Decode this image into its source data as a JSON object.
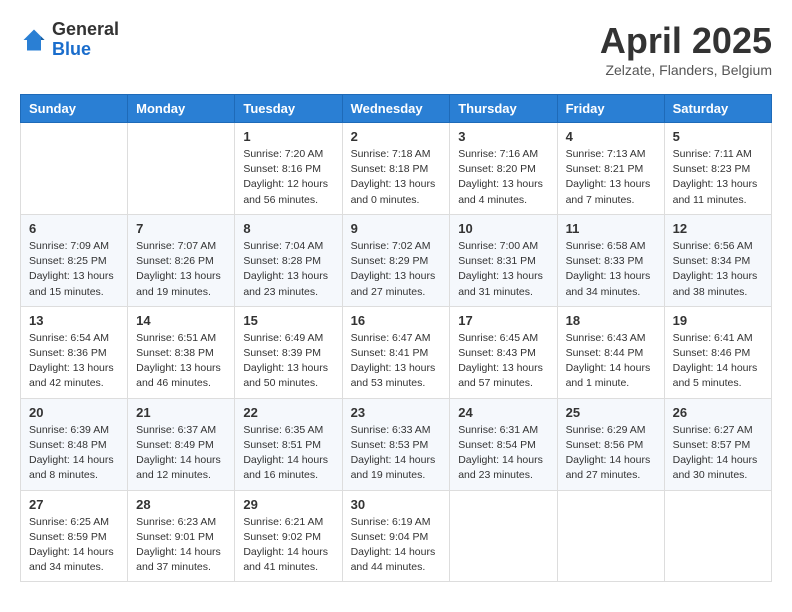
{
  "header": {
    "logo_general": "General",
    "logo_blue": "Blue",
    "month_title": "April 2025",
    "subtitle": "Zelzate, Flanders, Belgium"
  },
  "days_of_week": [
    "Sunday",
    "Monday",
    "Tuesday",
    "Wednesday",
    "Thursday",
    "Friday",
    "Saturday"
  ],
  "weeks": [
    [
      {
        "num": "",
        "info": ""
      },
      {
        "num": "",
        "info": ""
      },
      {
        "num": "1",
        "info": "Sunrise: 7:20 AM\nSunset: 8:16 PM\nDaylight: 12 hours and 56 minutes."
      },
      {
        "num": "2",
        "info": "Sunrise: 7:18 AM\nSunset: 8:18 PM\nDaylight: 13 hours and 0 minutes."
      },
      {
        "num": "3",
        "info": "Sunrise: 7:16 AM\nSunset: 8:20 PM\nDaylight: 13 hours and 4 minutes."
      },
      {
        "num": "4",
        "info": "Sunrise: 7:13 AM\nSunset: 8:21 PM\nDaylight: 13 hours and 7 minutes."
      },
      {
        "num": "5",
        "info": "Sunrise: 7:11 AM\nSunset: 8:23 PM\nDaylight: 13 hours and 11 minutes."
      }
    ],
    [
      {
        "num": "6",
        "info": "Sunrise: 7:09 AM\nSunset: 8:25 PM\nDaylight: 13 hours and 15 minutes."
      },
      {
        "num": "7",
        "info": "Sunrise: 7:07 AM\nSunset: 8:26 PM\nDaylight: 13 hours and 19 minutes."
      },
      {
        "num": "8",
        "info": "Sunrise: 7:04 AM\nSunset: 8:28 PM\nDaylight: 13 hours and 23 minutes."
      },
      {
        "num": "9",
        "info": "Sunrise: 7:02 AM\nSunset: 8:29 PM\nDaylight: 13 hours and 27 minutes."
      },
      {
        "num": "10",
        "info": "Sunrise: 7:00 AM\nSunset: 8:31 PM\nDaylight: 13 hours and 31 minutes."
      },
      {
        "num": "11",
        "info": "Sunrise: 6:58 AM\nSunset: 8:33 PM\nDaylight: 13 hours and 34 minutes."
      },
      {
        "num": "12",
        "info": "Sunrise: 6:56 AM\nSunset: 8:34 PM\nDaylight: 13 hours and 38 minutes."
      }
    ],
    [
      {
        "num": "13",
        "info": "Sunrise: 6:54 AM\nSunset: 8:36 PM\nDaylight: 13 hours and 42 minutes."
      },
      {
        "num": "14",
        "info": "Sunrise: 6:51 AM\nSunset: 8:38 PM\nDaylight: 13 hours and 46 minutes."
      },
      {
        "num": "15",
        "info": "Sunrise: 6:49 AM\nSunset: 8:39 PM\nDaylight: 13 hours and 50 minutes."
      },
      {
        "num": "16",
        "info": "Sunrise: 6:47 AM\nSunset: 8:41 PM\nDaylight: 13 hours and 53 minutes."
      },
      {
        "num": "17",
        "info": "Sunrise: 6:45 AM\nSunset: 8:43 PM\nDaylight: 13 hours and 57 minutes."
      },
      {
        "num": "18",
        "info": "Sunrise: 6:43 AM\nSunset: 8:44 PM\nDaylight: 14 hours and 1 minute."
      },
      {
        "num": "19",
        "info": "Sunrise: 6:41 AM\nSunset: 8:46 PM\nDaylight: 14 hours and 5 minutes."
      }
    ],
    [
      {
        "num": "20",
        "info": "Sunrise: 6:39 AM\nSunset: 8:48 PM\nDaylight: 14 hours and 8 minutes."
      },
      {
        "num": "21",
        "info": "Sunrise: 6:37 AM\nSunset: 8:49 PM\nDaylight: 14 hours and 12 minutes."
      },
      {
        "num": "22",
        "info": "Sunrise: 6:35 AM\nSunset: 8:51 PM\nDaylight: 14 hours and 16 minutes."
      },
      {
        "num": "23",
        "info": "Sunrise: 6:33 AM\nSunset: 8:53 PM\nDaylight: 14 hours and 19 minutes."
      },
      {
        "num": "24",
        "info": "Sunrise: 6:31 AM\nSunset: 8:54 PM\nDaylight: 14 hours and 23 minutes."
      },
      {
        "num": "25",
        "info": "Sunrise: 6:29 AM\nSunset: 8:56 PM\nDaylight: 14 hours and 27 minutes."
      },
      {
        "num": "26",
        "info": "Sunrise: 6:27 AM\nSunset: 8:57 PM\nDaylight: 14 hours and 30 minutes."
      }
    ],
    [
      {
        "num": "27",
        "info": "Sunrise: 6:25 AM\nSunset: 8:59 PM\nDaylight: 14 hours and 34 minutes."
      },
      {
        "num": "28",
        "info": "Sunrise: 6:23 AM\nSunset: 9:01 PM\nDaylight: 14 hours and 37 minutes."
      },
      {
        "num": "29",
        "info": "Sunrise: 6:21 AM\nSunset: 9:02 PM\nDaylight: 14 hours and 41 minutes."
      },
      {
        "num": "30",
        "info": "Sunrise: 6:19 AM\nSunset: 9:04 PM\nDaylight: 14 hours and 44 minutes."
      },
      {
        "num": "",
        "info": ""
      },
      {
        "num": "",
        "info": ""
      },
      {
        "num": "",
        "info": ""
      }
    ]
  ]
}
